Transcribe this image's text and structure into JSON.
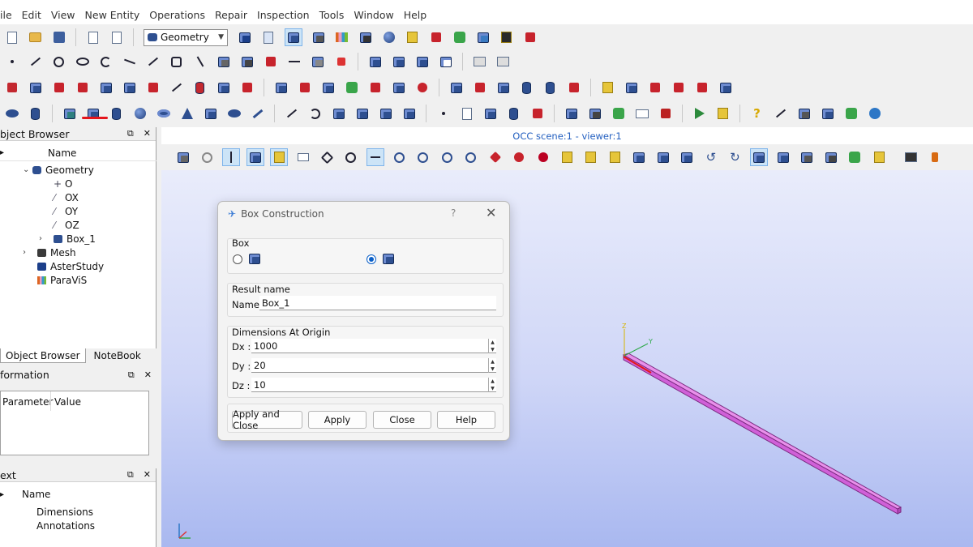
{
  "menu": [
    "ile",
    "Edit",
    "View",
    "New Entity",
    "Operations",
    "Repair",
    "Inspection",
    "Tools",
    "Window",
    "Help"
  ],
  "module_combo": {
    "value": "Geometry"
  },
  "object_browser": {
    "title": "bject Browser",
    "column": "Name",
    "items": {
      "geometry": "Geometry",
      "o": "O",
      "ox": "OX",
      "oy": "OY",
      "oz": "OZ",
      "box": "Box_1",
      "mesh": "Mesh",
      "asterstudy": "AsterStudy",
      "paravis": "ParaViS"
    },
    "tabs": [
      "Object Browser",
      "NoteBook"
    ]
  },
  "information": {
    "title": "formation",
    "col_param": "Parameter",
    "col_value": "Value"
  },
  "text_panel": {
    "title": "ext",
    "column": "Name",
    "items": [
      "Dimensions",
      "Annotations"
    ]
  },
  "viewer": {
    "title": "OCC scene:1 - viewer:1"
  },
  "dialog": {
    "title": "Box Construction",
    "help_glyph": "?",
    "close_glyph": "✕",
    "group_box": "Box",
    "group_result": "Result name",
    "name_label": "Name",
    "name_value": "Box_1",
    "group_dims": "Dimensions At Origin",
    "dx_label": "Dx :",
    "dx_value": "1000",
    "dy_label": "Dy :",
    "dy_value": "20",
    "dz_label": "Dz :",
    "dz_value": "10",
    "buttons": {
      "apply_close": "Apply and Close",
      "apply": "Apply",
      "close": "Close",
      "help": "Help"
    }
  },
  "colors": {
    "accent": "#0a5fc8",
    "box_shape": "#d060d8",
    "viewer_title": "#2460c0"
  }
}
